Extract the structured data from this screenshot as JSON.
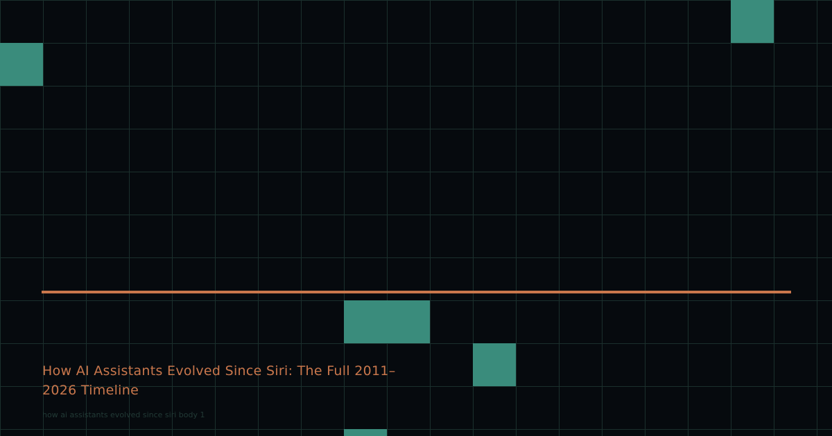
{
  "hero": {
    "title": "How AI Assistants Evolved Since Siri: The Full 2011–2026 Timeline",
    "body_text": "how ai assistants evolved since siri body 1"
  },
  "colors": {
    "background": "#060a0e",
    "grid_line": "#1b302d",
    "tile": "#3a8c7c",
    "accent": "#c9774c",
    "body_text": "#223a36"
  }
}
